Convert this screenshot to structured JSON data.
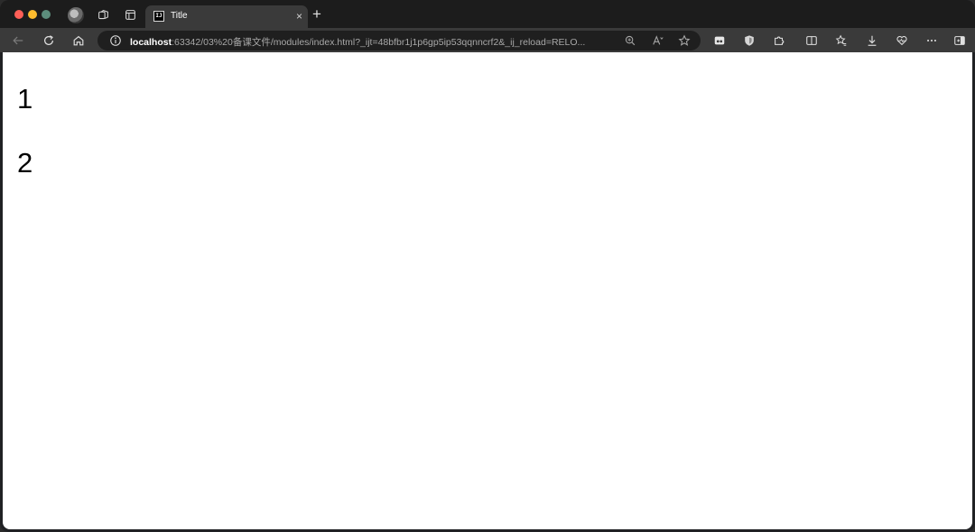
{
  "browser": {
    "tab": {
      "title": "Title",
      "favicon_text": "IJ"
    },
    "new_tab_label": "+",
    "close_tab_label": "×",
    "address_bar": {
      "host": "localhost",
      "rest": ":63342/03%20备课文件/modules/index.html?_ijt=48bfbr1j1p6gp5ip53qqnncrf2&_ij_reload=RELO..."
    },
    "toolbar_icons": [
      "back-icon",
      "reload-icon",
      "home-icon",
      "zoom-icon",
      "read-aloud-icon",
      "favorite-icon",
      "extension-icon",
      "shield-icon",
      "puzzle-icon",
      "split-screen-icon",
      "collections-icon",
      "downloads-icon",
      "heart-icon",
      "more-icon",
      "sidebar-icon"
    ],
    "colors": {
      "close": "#ff5f57",
      "minimize": "#febc2e",
      "maximize": "#5c8d7c"
    }
  },
  "page": {
    "lines": [
      "1",
      "2"
    ]
  }
}
